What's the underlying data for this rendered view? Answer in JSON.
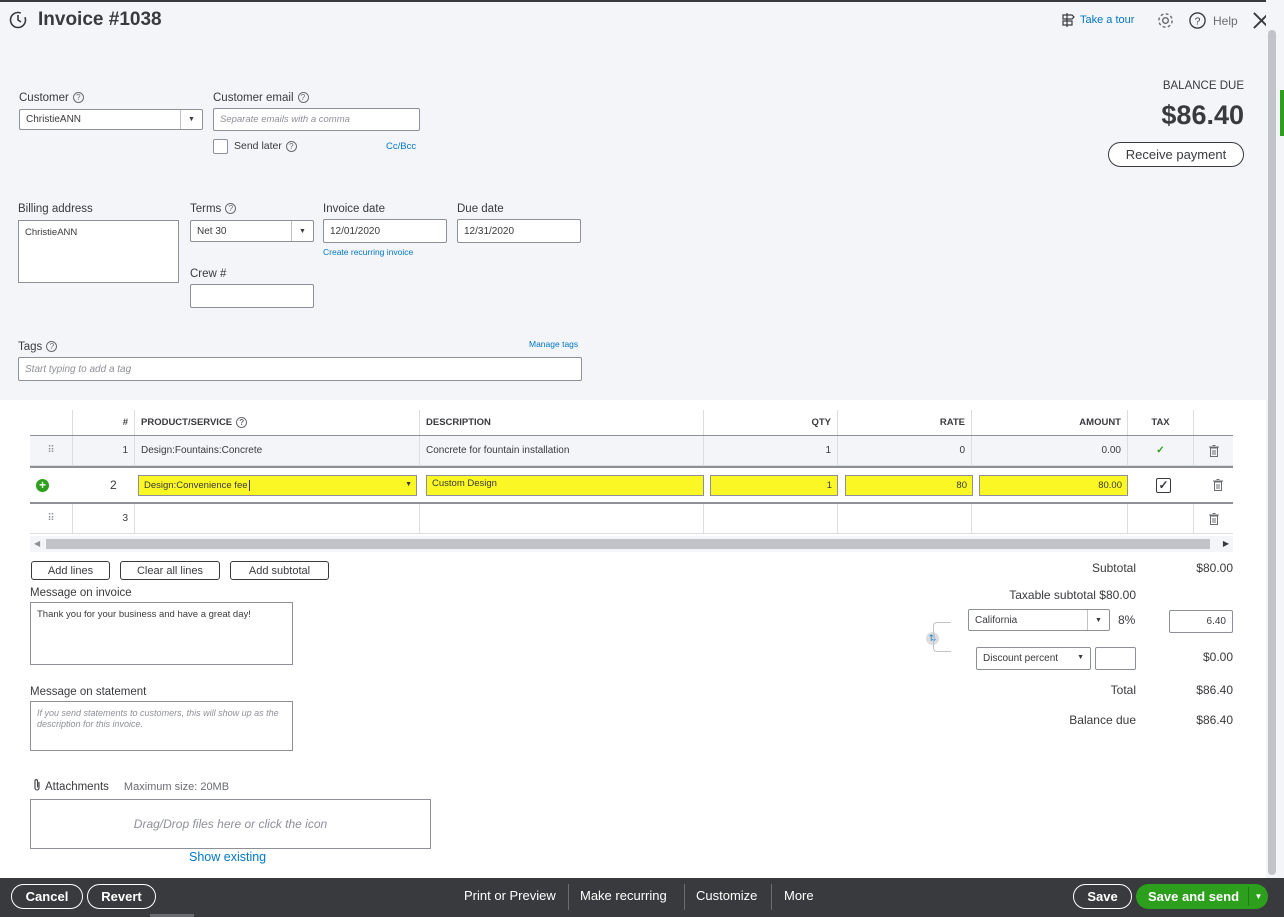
{
  "header": {
    "title": "Invoice #1038",
    "take_tour": "Take a tour",
    "help": "Help"
  },
  "customer": {
    "label": "Customer",
    "value": "ChristieANN",
    "email_label": "Customer email",
    "email_placeholder": "Separate emails with a comma",
    "send_later": "Send later",
    "cc_bcc": "Cc/Bcc"
  },
  "balance": {
    "label": "BALANCE DUE",
    "amount": "$86.40",
    "receive_payment": "Receive payment"
  },
  "billing": {
    "address_label": "Billing address",
    "address_value": "ChristieANN",
    "terms_label": "Terms",
    "terms_value": "Net 30",
    "invoice_date_label": "Invoice date",
    "invoice_date_value": "12/01/2020",
    "create_recurring": "Create recurring invoice",
    "due_date_label": "Due date",
    "due_date_value": "12/31/2020",
    "crew_label": "Crew #"
  },
  "tags": {
    "label": "Tags",
    "manage": "Manage tags",
    "placeholder": "Start typing to add a tag"
  },
  "table": {
    "headers": {
      "num": "#",
      "product": "PRODUCT/SERVICE",
      "description": "DESCRIPTION",
      "qty": "QTY",
      "rate": "RATE",
      "amount": "AMOUNT",
      "tax": "TAX"
    },
    "rows": [
      {
        "num": "1",
        "product": "Design:Fountains:Concrete",
        "description": "Concrete for fountain installation",
        "qty": "1",
        "rate": "0",
        "amount": "0.00",
        "tax": "✓"
      },
      {
        "num": "2",
        "product": "Design:Convenience fee",
        "description": "Custom Design",
        "qty": "1",
        "rate": "80",
        "amount": "80.00",
        "tax": "✓"
      },
      {
        "num": "3",
        "product": "",
        "description": "",
        "qty": "",
        "rate": "",
        "amount": "",
        "tax": ""
      }
    ]
  },
  "line_actions": {
    "add_lines": "Add lines",
    "clear_all": "Clear all lines",
    "add_subtotal": "Add subtotal"
  },
  "messages": {
    "invoice_label": "Message on invoice",
    "invoice_value": "Thank you for your business and have a great day!",
    "statement_label": "Message on statement",
    "statement_placeholder": "If you send statements to customers, this will show up as the description for this invoice."
  },
  "attachments": {
    "label": "Attachments",
    "max_size": "Maximum size: 20MB",
    "drop_text": "Drag/Drop files here or click the icon",
    "show_existing": "Show existing"
  },
  "totals": {
    "subtotal_label": "Subtotal",
    "subtotal_value": "$80.00",
    "taxable_label": "Taxable subtotal $80.00",
    "tax_region": "California",
    "tax_rate": "8%",
    "tax_amount": "6.40",
    "discount_type": "Discount percent",
    "discount_amount": "$0.00",
    "total_label": "Total",
    "total_value": "$86.40",
    "balance_label": "Balance due",
    "balance_value": "$86.40"
  },
  "footer": {
    "cancel": "Cancel",
    "revert": "Revert",
    "print_preview": "Print or Preview",
    "make_recurring": "Make recurring",
    "customize": "Customize",
    "more": "More",
    "save": "Save",
    "save_send": "Save and send"
  },
  "colors": {
    "brand_green": "#2ca01c",
    "link_blue": "#0077c5",
    "highlight_yellow": "#fbf724",
    "footer_bg": "#393a3d"
  }
}
